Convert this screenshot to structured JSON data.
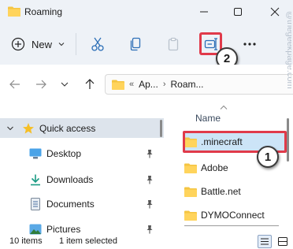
{
  "window": {
    "title": "Roaming"
  },
  "toolbar": {
    "new_label": "New"
  },
  "address": {
    "crumbs": [
      "Ap...",
      "Roam..."
    ]
  },
  "nav_pane": {
    "items": [
      {
        "label": "Quick access",
        "icon": "star-icon"
      },
      {
        "label": "Desktop",
        "icon": "desktop-icon"
      },
      {
        "label": "Downloads",
        "icon": "download-icon"
      },
      {
        "label": "Documents",
        "icon": "document-icon"
      },
      {
        "label": "Pictures",
        "icon": "picture-icon"
      }
    ]
  },
  "file_list": {
    "column_header": "Name",
    "files": [
      ".minecraft",
      "Adobe",
      "Battle.net",
      "DYMOConnect"
    ]
  },
  "status": {
    "count": "10 items",
    "selection": "1 item selected"
  },
  "callouts": {
    "first": "1",
    "second": "2"
  },
  "watermark": {
    "text": "@thegeekpage.com"
  },
  "colors": {
    "highlight_red": "#e03a4a",
    "folder_yellow": "#f4c542",
    "selection_blue": "#cce4f7",
    "chrome_bg": "#eef2f7"
  }
}
